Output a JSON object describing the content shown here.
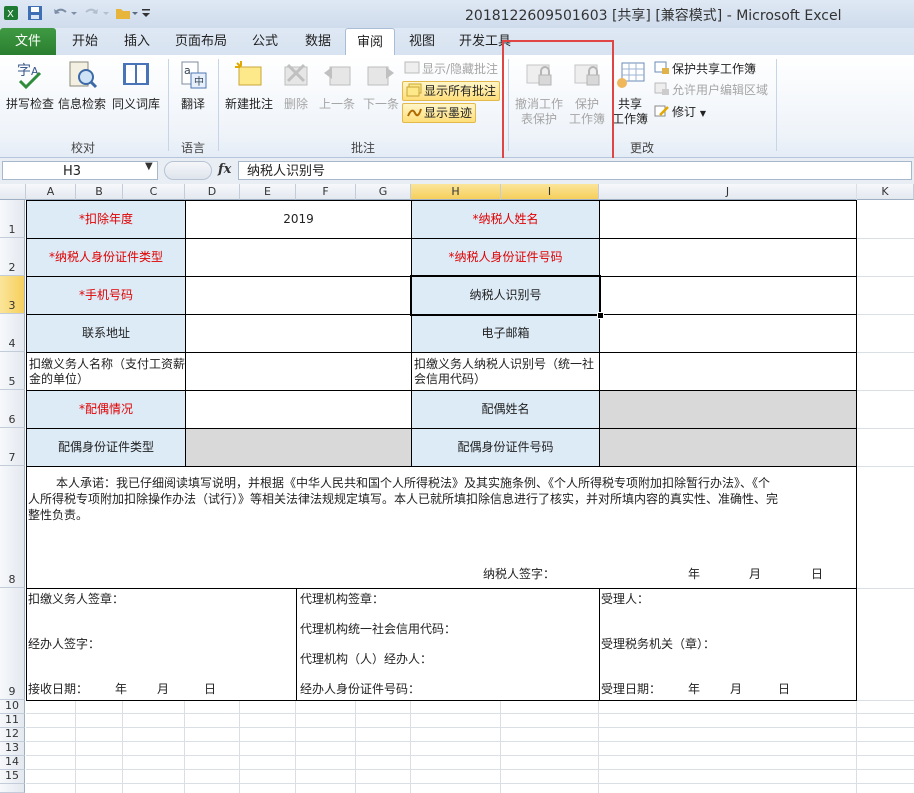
{
  "window": {
    "title": "2018122609501603  [共享]  [兼容模式]  -  Microsoft Excel"
  },
  "tabs": [
    "文件",
    "开始",
    "插入",
    "页面布局",
    "公式",
    "数据",
    "审阅",
    "视图",
    "开发工具"
  ],
  "ribbon": {
    "proofing": {
      "spell": "拼写检查",
      "research": "信息检索",
      "thesaurus": "同义词库",
      "label": "校对"
    },
    "language": {
      "translate": "翻译",
      "label": "语言"
    },
    "comments": {
      "new": "新建批注",
      "delete": "删除",
      "prev": "上一条",
      "next": "下一条",
      "show_hide": "显示/隐藏批注",
      "show_all": "显示所有批注",
      "show_ink": "显示墨迹",
      "label": "批注"
    },
    "changes": {
      "unprotect_sheet_1": "撤消工作",
      "unprotect_sheet_2": "表保护",
      "protect_wb_1": "保护",
      "protect_wb_2": "工作簿",
      "share_1": "共享",
      "share_2": "工作簿",
      "protect_share": "保护共享工作簿",
      "allow_edit": "允许用户编辑区域",
      "track": "修订",
      "label": "更改"
    }
  },
  "formula_bar": {
    "name_box": "H3",
    "fx": "fx",
    "content": "纳税人识别号"
  },
  "columns": [
    "A",
    "B",
    "C",
    "D",
    "E",
    "F",
    "G",
    "H",
    "I",
    "J",
    "K"
  ],
  "rows": [
    "1",
    "2",
    "3",
    "4",
    "5",
    "6",
    "7",
    "8",
    "9",
    "10",
    "11",
    "12",
    "13",
    "14",
    "15"
  ],
  "sheet": {
    "r1": {
      "label_left": "*扣除年度",
      "value_left": "2019",
      "label_right": "*纳税人姓名"
    },
    "r2": {
      "label_left": "*纳税人身份证件类型",
      "label_right": "*纳税人身份证件号码"
    },
    "r3": {
      "label_left": "*手机号码",
      "label_right": "纳税人识别号"
    },
    "r4": {
      "label_left": "联系地址",
      "label_right": "电子邮箱"
    },
    "r5": {
      "label_left": "扣缴义务人名称（支付工资薪金的单位）",
      "label_right": "扣缴义务人纳税人识别号（统一社会信用代码）"
    },
    "r6": {
      "label_left": "*配偶情况",
      "label_right": "配偶姓名"
    },
    "r7": {
      "label_left": "配偶身份证件类型",
      "label_right": "配偶身份证件号码"
    },
    "r8": {
      "pledge_line1": "本人承诺：我已仔细阅读填写说明，并根据《中华人民共和国个人所得税法》及其实施条例、《个人所得税专项附加扣除暂行办法》、《个",
      "pledge_line2": "人所得税专项附加扣除操作办法（试行）》等相关法律法规规定填写。本人已就所填扣除信息进行了核实，并对所填内容的真实性、准确性、完",
      "pledge_line3": "整性负责。",
      "sign": "纳税人签字：",
      "year": "年",
      "month": "月",
      "day": "日"
    },
    "r9": {
      "withholder_seal": "扣缴义务人签章：",
      "handler_sign": "经办人签字：",
      "receive_date": "接收日期：",
      "year": "年",
      "month": "月",
      "day": "日",
      "agency_seal": "代理机构签章：",
      "agency_credit": "代理机构统一社会信用代码：",
      "agency_handler": "代理机构（人）经办人：",
      "handler_id": "经办人身份证件号码：",
      "acceptor": "受理人：",
      "tax_office": "受理税务机关（章）：",
      "accept_date": "受理日期："
    }
  }
}
